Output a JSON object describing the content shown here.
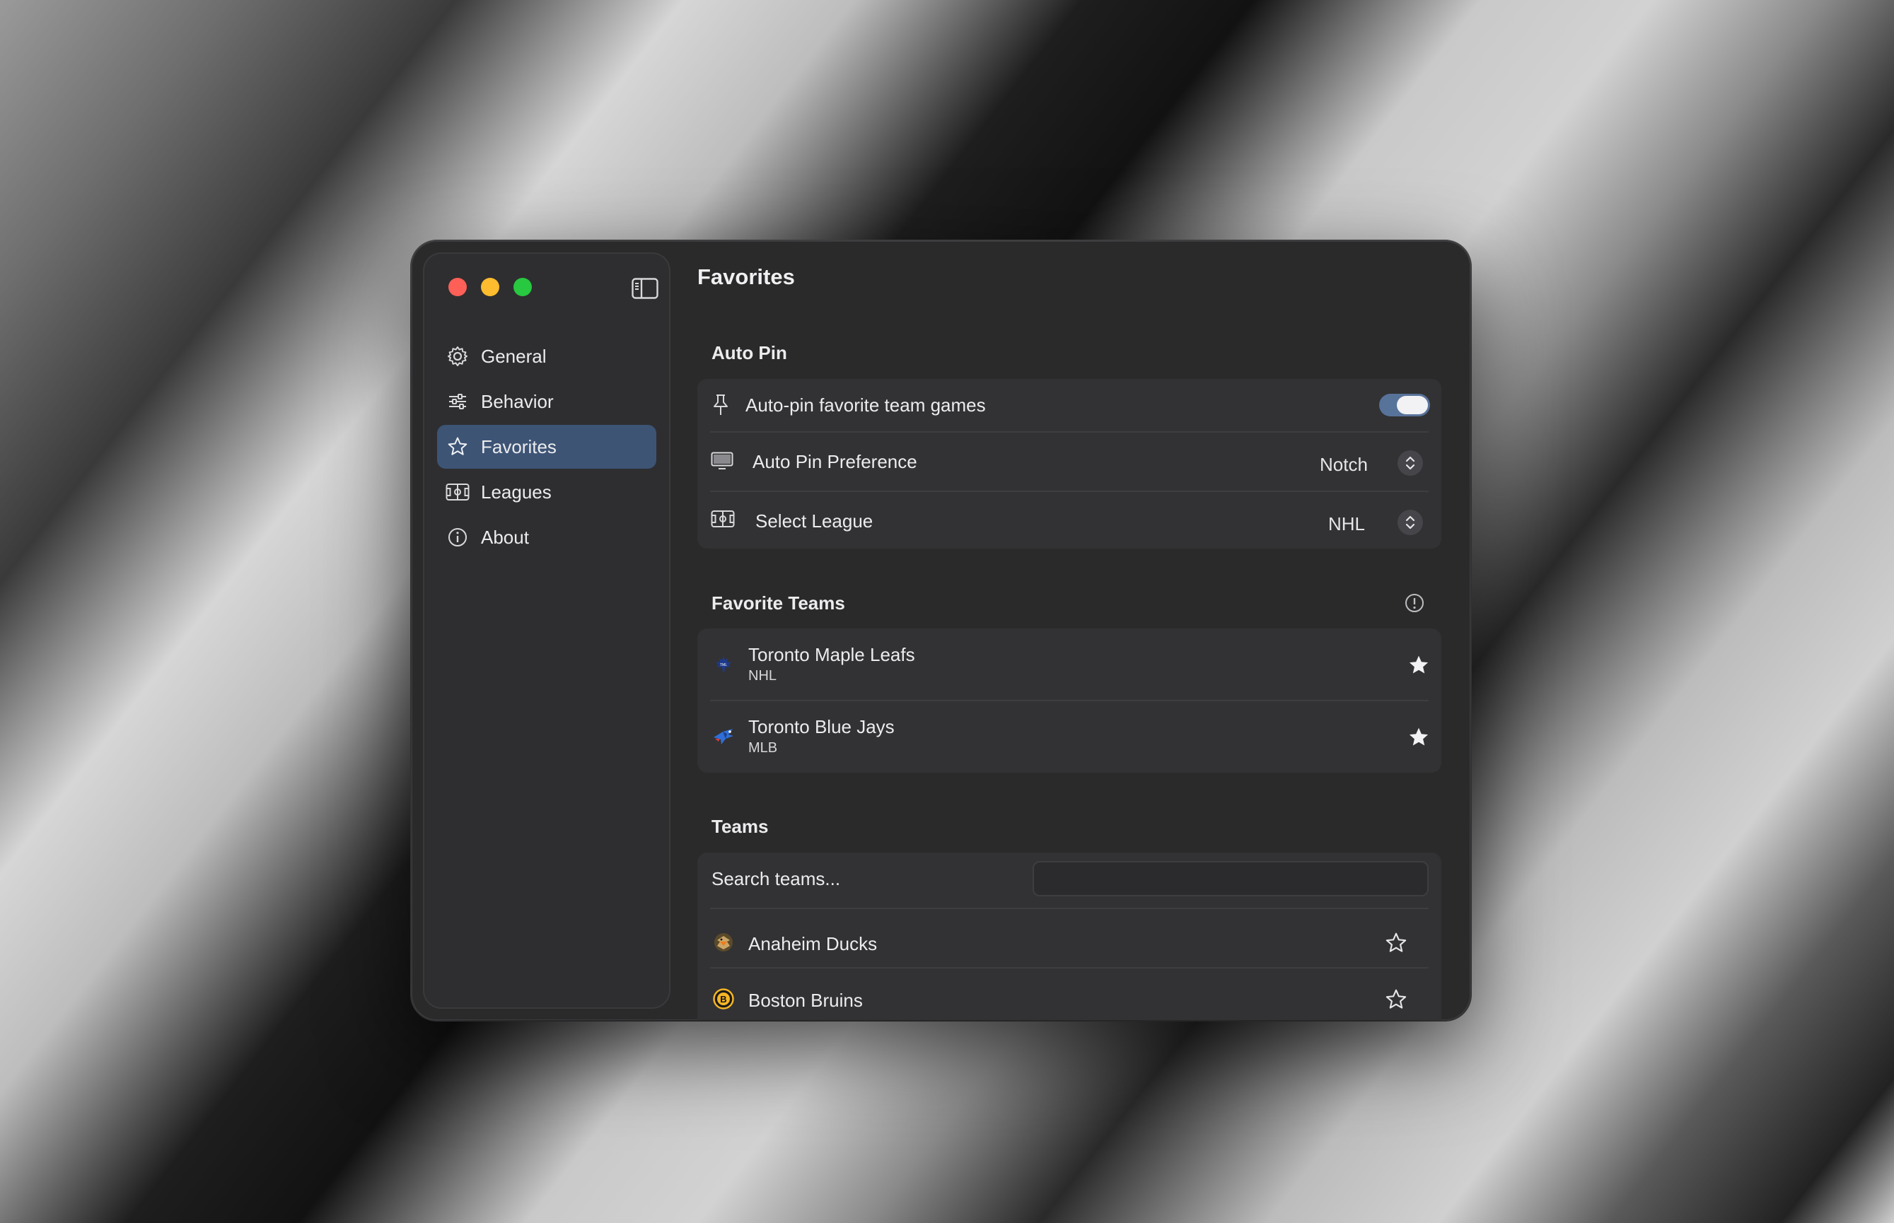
{
  "window": {
    "title": "Favorites"
  },
  "sidebar": {
    "items": [
      {
        "label": "General",
        "icon": "gear-icon"
      },
      {
        "label": "Behavior",
        "icon": "sliders-icon"
      },
      {
        "label": "Favorites",
        "icon": "star-icon",
        "active": true
      },
      {
        "label": "Leagues",
        "icon": "field-icon"
      },
      {
        "label": "About",
        "icon": "info-icon"
      }
    ]
  },
  "auto_pin": {
    "heading": "Auto Pin",
    "toggle_label": "Auto-pin favorite team games",
    "toggle_on": true,
    "preference_label": "Auto Pin Preference",
    "preference_value": "Notch",
    "league_label": "Select League",
    "league_value": "NHL"
  },
  "favorite_teams": {
    "heading": "Favorite Teams",
    "items": [
      {
        "name": "Toronto Maple Leafs",
        "league": "NHL",
        "icon": "maple-leaf-logo-icon"
      },
      {
        "name": "Toronto Blue Jays",
        "league": "MLB",
        "icon": "blue-jay-logo-icon"
      }
    ]
  },
  "teams": {
    "heading": "Teams",
    "search_label": "Search teams...",
    "search_value": "",
    "items": [
      {
        "name": "Anaheim Ducks",
        "icon": "ducks-logo-icon"
      },
      {
        "name": "Boston Bruins",
        "icon": "bruins-logo-icon"
      }
    ]
  },
  "colors": {
    "accent": "#3d5475",
    "toggle_on": "#58739a",
    "window_bg": "#2a2a2b",
    "card_bg": "#323234"
  }
}
